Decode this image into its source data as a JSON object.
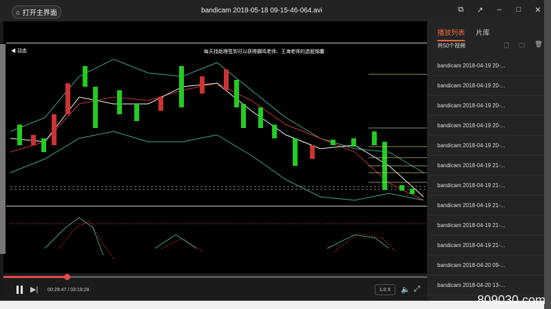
{
  "titlebar": {
    "home_label": "打开主界面",
    "title": "bandicam 2018-05-18 09-15-46-064.avi"
  },
  "video": {
    "overlay_sound": "动态",
    "caption": "每天找助理签到可以获得霸鸣老师、王海老师的选股锦囊"
  },
  "controls": {
    "current_time": "00:29:47",
    "total_time": "03:19:28",
    "speed": "1.0 X",
    "progress_fraction": 0.15
  },
  "playlist": {
    "tabs": [
      {
        "label": "播放列表",
        "active": true
      },
      {
        "label": "片库",
        "active": false
      }
    ],
    "count": "共50个视频",
    "items": [
      "bandicam 2018-04-19 20-...",
      "bandicam 2018-04-19 20-...",
      "bandicam 2018-04-19 20-...",
      "bandicam 2018-04-19 20-...",
      "bandicam 2018-04-19 20-...",
      "bandicam 2018-04-19 21-...",
      "bandicam 2018-04-19 21-...",
      "bandicam 2018-04-19 21-...",
      "bandicam 2018-04-19 21-...",
      "bandicam 2018-04-19 21-...",
      "bandicam 2018-04-20 09-...",
      "bandicam 2018-04-20 13-..."
    ]
  },
  "watermark": "809030.com"
}
